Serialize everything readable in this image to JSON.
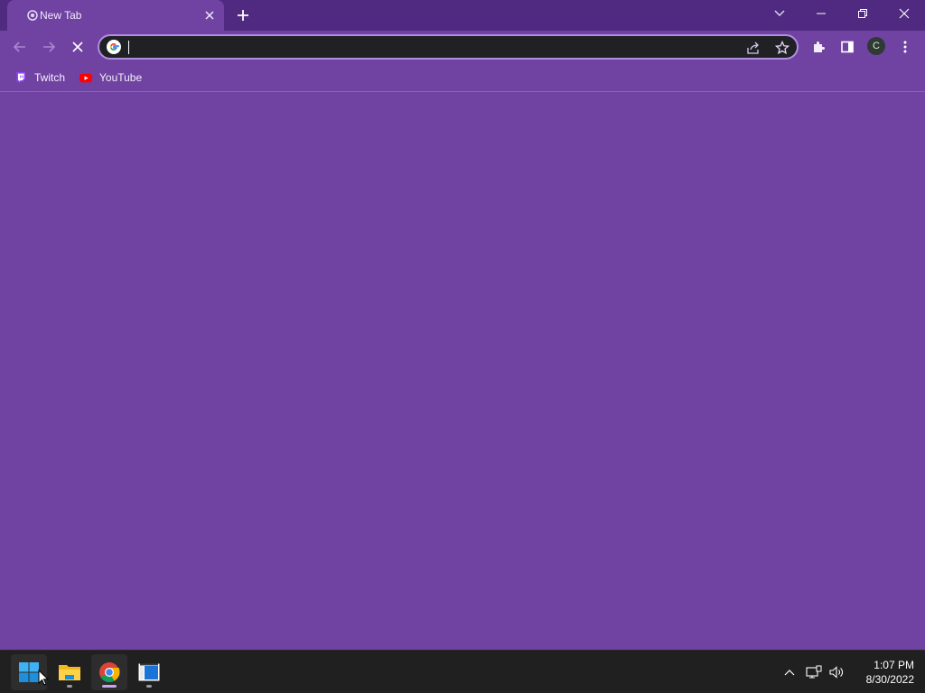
{
  "browser": {
    "tab": {
      "title": "New Tab"
    },
    "omnibox": {
      "value": "",
      "placeholder": ""
    },
    "profile_initial": "C",
    "bookmarks": [
      {
        "label": "Twitch",
        "icon": "twitch-icon"
      },
      {
        "label": "YouTube",
        "icon": "youtube-icon"
      }
    ]
  },
  "taskbar": {
    "apps": [
      {
        "name": "start",
        "icon": "windows-start-icon"
      },
      {
        "name": "file-explorer",
        "icon": "folder-icon"
      },
      {
        "name": "chrome",
        "icon": "chrome-icon"
      },
      {
        "name": "notepad",
        "icon": "app-icon"
      }
    ],
    "clock": {
      "time": "1:07 PM",
      "date": "8/30/2022"
    }
  },
  "colors": {
    "theme_purple": "#7043a3",
    "tabstrip_purple": "#4f2a80",
    "taskbar": "#202020",
    "omnibox_bg": "#202124"
  }
}
